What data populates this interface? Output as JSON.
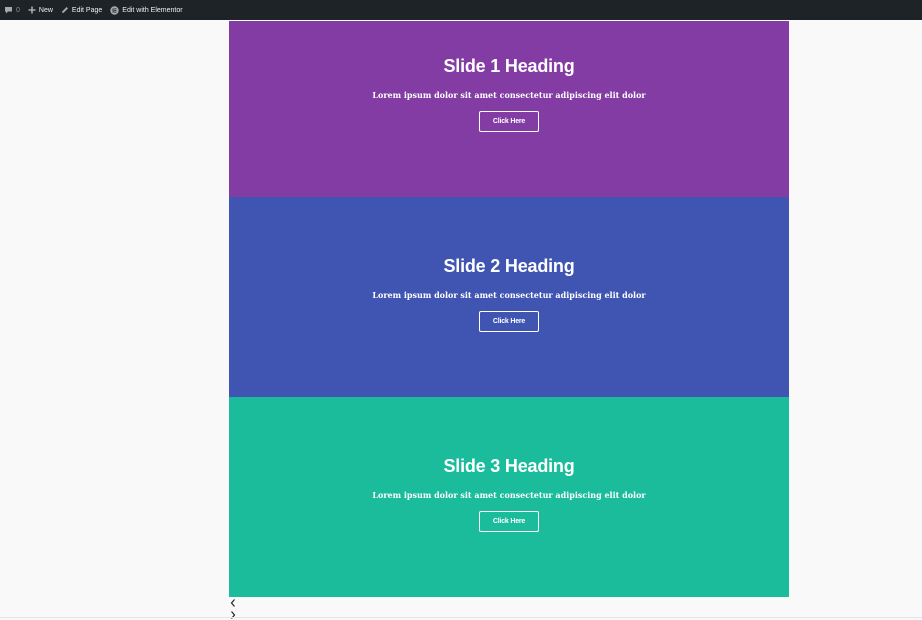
{
  "admin_bar": {
    "comments_count": "0",
    "new_label": "New",
    "edit_page_label": "Edit Page",
    "elementor_label": "Edit with Elementor"
  },
  "slides": [
    {
      "heading": "Slide 1 Heading",
      "description": "Lorem ipsum dolor sit amet consectetur adipiscing elit dolor",
      "button_label": "Click Here",
      "background": "#833ca3"
    },
    {
      "heading": "Slide 2 Heading",
      "description": "Lorem ipsum dolor sit amet consectetur adipiscing elit dolor",
      "button_label": "Click Here",
      "background": "#4054b2"
    },
    {
      "heading": "Slide 3 Heading",
      "description": "Lorem ipsum dolor sit amet consectetur adipiscing elit dolor",
      "button_label": "Click Here",
      "background": "#1abc9c"
    }
  ],
  "navigation": {
    "prev_icon": "chevron-left-icon",
    "next_icon": "chevron-right-icon"
  },
  "colors": {
    "admin_bar_bg": "#1d2327",
    "page_bg": "#f9f9f9"
  }
}
